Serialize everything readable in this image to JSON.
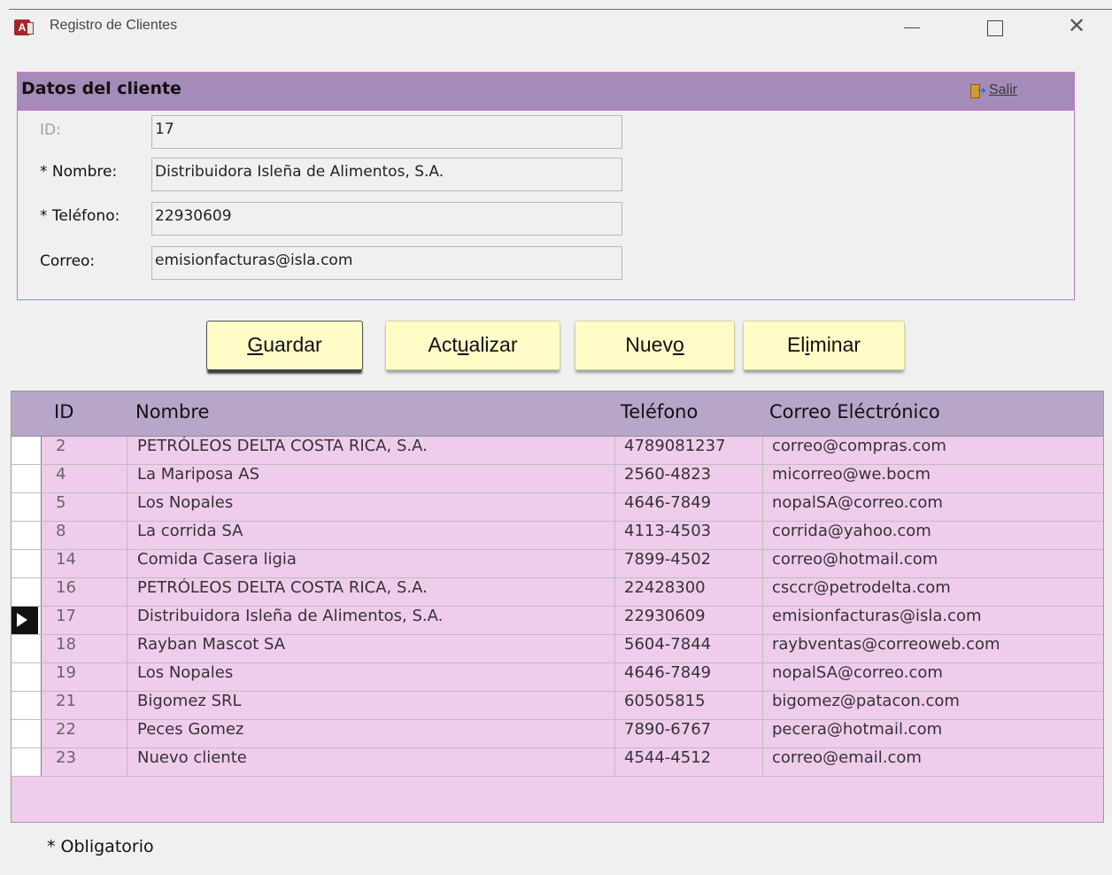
{
  "window": {
    "app_icon": "access-icon",
    "title": "Registro de Clientes"
  },
  "form": {
    "title": "Datos del cliente",
    "exit_label": "Salir",
    "fields": {
      "id": {
        "label": "ID:",
        "value": "17"
      },
      "nombre": {
        "label": "* Nombre:",
        "value": "Distribuidora Isleña de Alimentos, S.A."
      },
      "telefono": {
        "label": "* Teléfono:",
        "value": "22930609"
      },
      "correo": {
        "label": "Correo:",
        "value": "emisionfacturas@isla.com"
      }
    }
  },
  "buttons": {
    "guardar": {
      "pre": "",
      "acc": "G",
      "post": "uardar"
    },
    "actualizar": {
      "pre": "Act",
      "acc": "u",
      "post": "alizar"
    },
    "nuevo": {
      "pre": "Nuev",
      "acc": "o",
      "post": ""
    },
    "eliminar": {
      "pre": "El",
      "acc": "i",
      "post": "minar"
    }
  },
  "table": {
    "headers": {
      "id": "ID",
      "nombre": "Nombre",
      "telefono": "Teléfono",
      "correo": "Correo Eléctrónico"
    },
    "current_row_index": 6,
    "rows": [
      {
        "id": "2",
        "nombre": "PETRÓLEOS DELTA COSTA RICA, S.A.",
        "telefono": "4789081237",
        "correo": "correo@compras.com"
      },
      {
        "id": "4",
        "nombre": "La Mariposa AS",
        "telefono": "2560-4823",
        "correo": "micorreo@we.bocm"
      },
      {
        "id": "5",
        "nombre": "Los Nopales",
        "telefono": "4646-7849",
        "correo": "nopalSA@correo.com"
      },
      {
        "id": "8",
        "nombre": "La corrida SA",
        "telefono": "4113-4503",
        "correo": "corrida@yahoo.com"
      },
      {
        "id": "14",
        "nombre": "Comida Casera ligia",
        "telefono": "7899-4502",
        "correo": "correo@hotmail.com"
      },
      {
        "id": "16",
        "nombre": "PETRÓLEOS DELTA COSTA RICA, S.A.",
        "telefono": "22428300",
        "correo": "csccr@petrodelta.com"
      },
      {
        "id": "17",
        "nombre": "Distribuidora Isleña de Alimentos, S.A.",
        "telefono": "22930609",
        "correo": "emisionfacturas@isla.com"
      },
      {
        "id": "18",
        "nombre": "Rayban Mascot SA",
        "telefono": "5604-7844",
        "correo": "raybventas@correoweb.com"
      },
      {
        "id": "19",
        "nombre": "Los Nopales",
        "telefono": "4646-7849",
        "correo": "nopalSA@correo.com"
      },
      {
        "id": "21",
        "nombre": "Bigomez SRL",
        "telefono": "60505815",
        "correo": "bigomez@patacon.com"
      },
      {
        "id": "22",
        "nombre": "Peces Gomez",
        "telefono": "7890-6767",
        "correo": "pecera@hotmail.com"
      },
      {
        "id": "23",
        "nombre": "Nuevo cliente",
        "telefono": "4544-4512",
        "correo": "correo@email.com"
      }
    ]
  },
  "footnote": "* Obligatorio",
  "colors": {
    "header_band": "#a58bb9",
    "panel_border": "#c776c7",
    "grid_header": "#b7a6c9",
    "grid_body": "#f0ccec",
    "button_face": "#fffcc8"
  }
}
